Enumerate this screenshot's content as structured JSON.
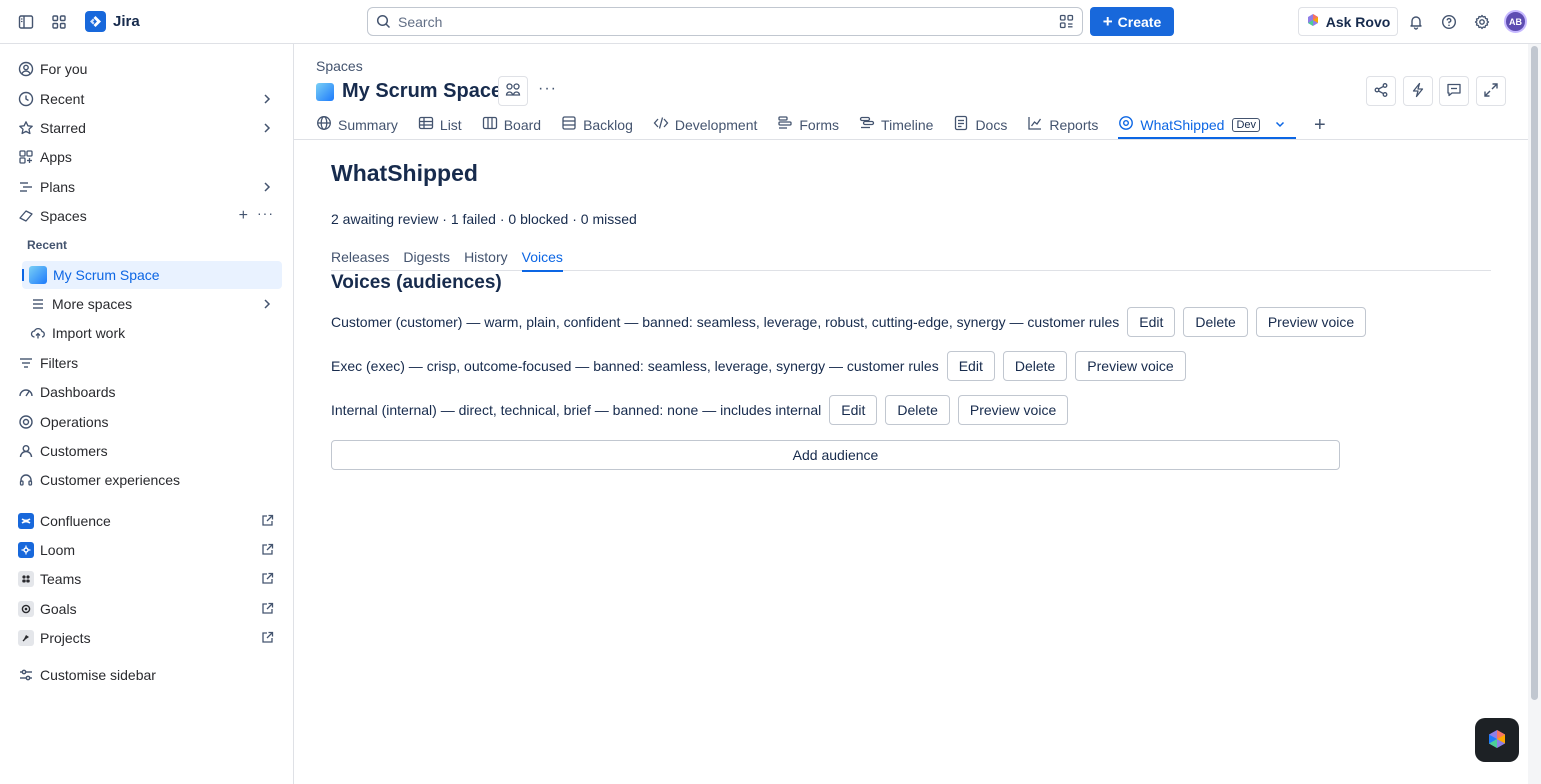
{
  "topbar": {
    "app_name": "Jira",
    "search_placeholder": "Search",
    "create_label": "Create",
    "ask_rovo_label": "Ask Rovo",
    "avatar_initials": "AB"
  },
  "sidebar": {
    "items": [
      {
        "label": "For you",
        "icon": "user-circle-icon"
      },
      {
        "label": "Recent",
        "icon": "clock-icon"
      },
      {
        "label": "Starred",
        "icon": "star-icon"
      },
      {
        "label": "Apps",
        "icon": "apps-icon"
      },
      {
        "label": "Plans",
        "icon": "plans-icon"
      },
      {
        "label": "Spaces",
        "icon": "spaces-icon"
      }
    ],
    "recent_heading": "Recent",
    "recent_space": "My Scrum Space",
    "more_spaces": "More spaces",
    "import_work": "Import work",
    "lower_items": [
      {
        "label": "Filters",
        "icon": "filter-icon"
      },
      {
        "label": "Dashboards",
        "icon": "dashboard-icon"
      },
      {
        "label": "Operations",
        "icon": "operations-icon"
      },
      {
        "label": "Customers",
        "icon": "customers-icon"
      },
      {
        "label": "Customer experiences",
        "icon": "headset-icon"
      }
    ],
    "apps": [
      {
        "label": "Confluence",
        "color": "#1868db"
      },
      {
        "label": "Loom",
        "color": "#1868db"
      },
      {
        "label": "Teams",
        "color": "#292a2e"
      },
      {
        "label": "Goals",
        "color": "#292a2e"
      },
      {
        "label": "Projects",
        "color": "#292a2e"
      }
    ],
    "customise": "Customise sidebar"
  },
  "main": {
    "breadcrumb": "Spaces",
    "space_name": "My Scrum Space",
    "tabs": [
      {
        "label": "Summary"
      },
      {
        "label": "List"
      },
      {
        "label": "Board"
      },
      {
        "label": "Backlog"
      },
      {
        "label": "Development"
      },
      {
        "label": "Forms"
      },
      {
        "label": "Timeline"
      },
      {
        "label": "Docs"
      },
      {
        "label": "Reports"
      },
      {
        "label": "WhatShipped",
        "badge": "Dev"
      }
    ],
    "page_title": "WhatShipped",
    "summary": "2 awaiting review · 1 failed · 0 blocked · 0 missed",
    "subtabs": [
      "Releases",
      "Digests",
      "History",
      "Voices"
    ],
    "section_title": "Voices (audiences)",
    "voices": [
      {
        "text": "Customer (customer) — warm, plain, confident — banned: seamless, leverage, robust, cutting-edge, synergy — customer rules"
      },
      {
        "text": "Exec (exec) — crisp, outcome-focused — banned: seamless, leverage, synergy — customer rules"
      },
      {
        "text": "Internal (internal) — direct, technical, brief — banned: none — includes internal"
      }
    ],
    "edit_label": "Edit",
    "delete_label": "Delete",
    "preview_label": "Preview voice",
    "add_audience_label": "Add audience"
  },
  "colors": {
    "accent": "#1868db",
    "active_text": "#0c66e4"
  }
}
